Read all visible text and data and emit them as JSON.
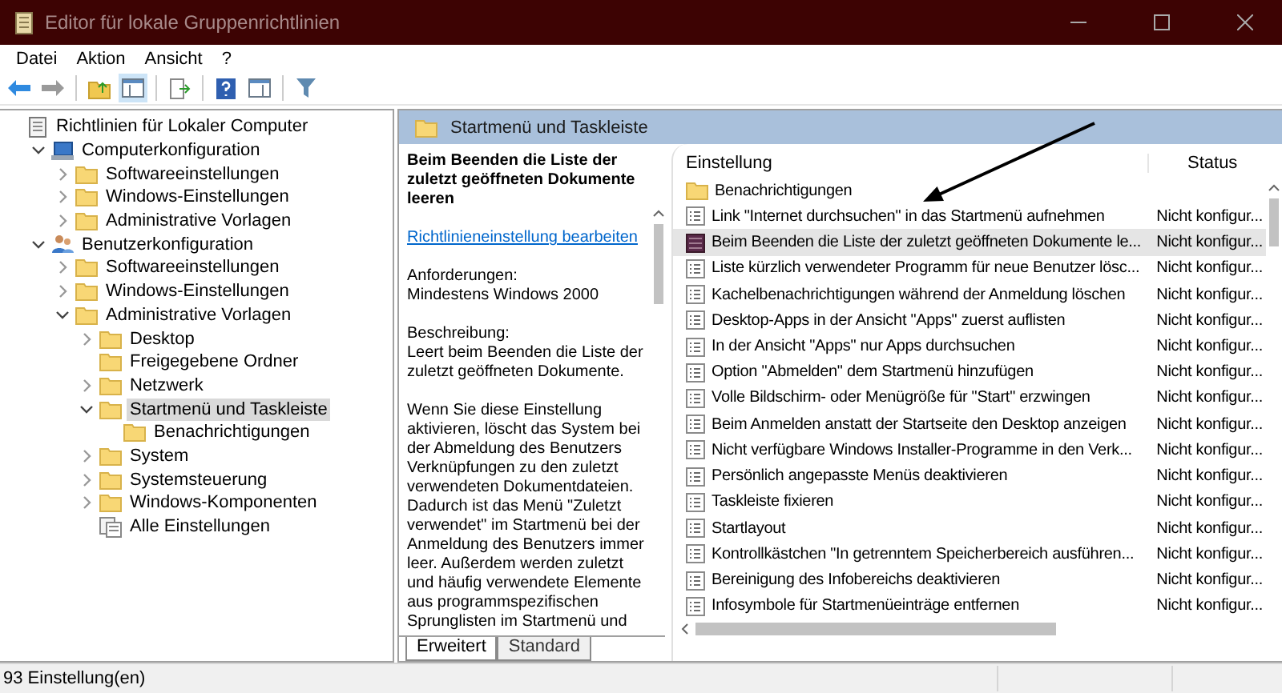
{
  "window": {
    "title": "Editor für lokale Gruppenrichtlinien"
  },
  "menu": [
    "Datei",
    "Aktion",
    "Ansicht",
    "?"
  ],
  "tree": [
    {
      "label": "Richtlinien für Lokaler Computer",
      "kind": "policy",
      "selected": false,
      "children": [
        {
          "label": "Computerkonfiguration",
          "kind": "computer",
          "expanded": true,
          "selected": false,
          "children": [
            {
              "label": "Softwareeinstellungen",
              "kind": "folder",
              "expanded": false,
              "selected": false
            },
            {
              "label": "Windows-Einstellungen",
              "kind": "folder",
              "expanded": false,
              "selected": false
            },
            {
              "label": "Administrative Vorlagen",
              "kind": "folder",
              "expanded": false,
              "selected": false
            }
          ]
        },
        {
          "label": "Benutzerkonfiguration",
          "kind": "user",
          "expanded": true,
          "selected": false,
          "children": [
            {
              "label": "Softwareeinstellungen",
              "kind": "folder",
              "expanded": false,
              "selected": false
            },
            {
              "label": "Windows-Einstellungen",
              "kind": "folder",
              "expanded": false,
              "selected": false
            },
            {
              "label": "Administrative Vorlagen",
              "kind": "folder",
              "expanded": true,
              "selected": false,
              "children": [
                {
                  "label": "Desktop",
                  "kind": "folder",
                  "expanded": false,
                  "selected": false
                },
                {
                  "label": "Freigegebene Ordner",
                  "kind": "folder",
                  "selected": false
                },
                {
                  "label": "Netzwerk",
                  "kind": "folder",
                  "expanded": false,
                  "selected": false
                },
                {
                  "label": "Startmenü und Taskleiste",
                  "kind": "folder",
                  "expanded": true,
                  "selected": true,
                  "children": [
                    {
                      "label": "Benachrichtigungen",
                      "kind": "folder",
                      "selected": false
                    }
                  ]
                },
                {
                  "label": "System",
                  "kind": "folder",
                  "expanded": false,
                  "selected": false
                },
                {
                  "label": "Systemsteuerung",
                  "kind": "folder",
                  "expanded": false,
                  "selected": false
                },
                {
                  "label": "Windows-Komponenten",
                  "kind": "folder",
                  "expanded": false,
                  "selected": false
                },
                {
                  "label": "Alle Einstellungen",
                  "kind": "all",
                  "selected": false
                }
              ]
            }
          ]
        }
      ]
    }
  ],
  "detail_header": {
    "title": "Startmenü und Taskleiste"
  },
  "description": {
    "title": "Beim Beenden die Liste der zuletzt geöffneten Dokumente leeren",
    "link": "Richtlinieneinstellung bearbeiten",
    "requirements_label": "Anforderungen:",
    "requirements": "Mindestens Windows 2000",
    "description_label": "Beschreibung:",
    "description": "Leert beim Beenden die Liste der zuletzt geöffneten Dokumente.",
    "body": "Wenn Sie diese Einstellung aktivieren, löscht das System bei der Abmeldung des Benutzers Verknüpfungen zu den zuletzt verwendeten Dokumentdateien. Dadurch ist das Menü \"Zuletzt verwendet\" im Startmenü bei der Anmeldung des Benutzers immer leer. Außerdem werden zuletzt und häufig verwendete Elemente aus programmspezifischen Sprunglisten im Startmenü und"
  },
  "tabs": [
    {
      "label": "Erweitert",
      "selected": true
    },
    {
      "label": "Standard",
      "selected": false
    }
  ],
  "table": {
    "columns": [
      "Einstellung",
      "Status"
    ],
    "rows": [
      {
        "kind": "folder",
        "name": "Benachrichtigungen",
        "selected": false
      },
      {
        "kind": "setting",
        "name": "Link \"Internet durchsuchen\" in das Startmenü aufnehmen",
        "status": "Nicht konfigur...",
        "selected": false
      },
      {
        "kind": "setting",
        "name": "Beim Beenden die Liste der zuletzt geöffneten Dokumente le...",
        "status": "Nicht konfigur...",
        "selected": true
      },
      {
        "kind": "setting",
        "name": "Liste kürzlich verwendeter Programm für neue Benutzer lösc...",
        "status": "Nicht konfigur...",
        "selected": false
      },
      {
        "kind": "setting",
        "name": "Kachelbenachrichtigungen während der Anmeldung löschen",
        "status": "Nicht konfigur...",
        "selected": false
      },
      {
        "kind": "setting",
        "name": "Desktop-Apps in der Ansicht \"Apps\" zuerst auflisten",
        "status": "Nicht konfigur...",
        "selected": false
      },
      {
        "kind": "setting",
        "name": "In der Ansicht \"Apps\" nur Apps durchsuchen",
        "status": "Nicht konfigur...",
        "selected": false
      },
      {
        "kind": "setting",
        "name": "Option \"Abmelden\" dem Startmenü hinzufügen",
        "status": "Nicht konfigur...",
        "selected": false
      },
      {
        "kind": "setting",
        "name": "Volle Bildschirm- oder Menügröße für \"Start\" erzwingen",
        "status": "Nicht konfigur...",
        "selected": false
      },
      {
        "kind": "setting",
        "name": "Beim Anmelden anstatt der Startseite den Desktop anzeigen",
        "status": "Nicht konfigur...",
        "selected": false
      },
      {
        "kind": "setting",
        "name": "Nicht verfügbare Windows Installer-Programme in den Verk...",
        "status": "Nicht konfigur...",
        "selected": false
      },
      {
        "kind": "setting",
        "name": "Persönlich angepasste Menüs deaktivieren",
        "status": "Nicht konfigur...",
        "selected": false
      },
      {
        "kind": "setting",
        "name": "Taskleiste fixieren",
        "status": "Nicht konfigur...",
        "selected": false
      },
      {
        "kind": "setting",
        "name": "Startlayout",
        "status": "Nicht konfigur...",
        "selected": false
      },
      {
        "kind": "setting",
        "name": "Kontrollkästchen \"In getrenntem Speicherbereich ausführen...",
        "status": "Nicht konfigur...",
        "selected": false
      },
      {
        "kind": "setting",
        "name": "Bereinigung des Infobereichs deaktivieren",
        "status": "Nicht konfigur...",
        "selected": false
      },
      {
        "kind": "setting",
        "name": "Infosymbole für Startmenüeinträge entfernen",
        "status": "Nicht konfigur...",
        "selected": false
      }
    ]
  },
  "status_bar": {
    "text": "93 Einstellung(en)"
  }
}
